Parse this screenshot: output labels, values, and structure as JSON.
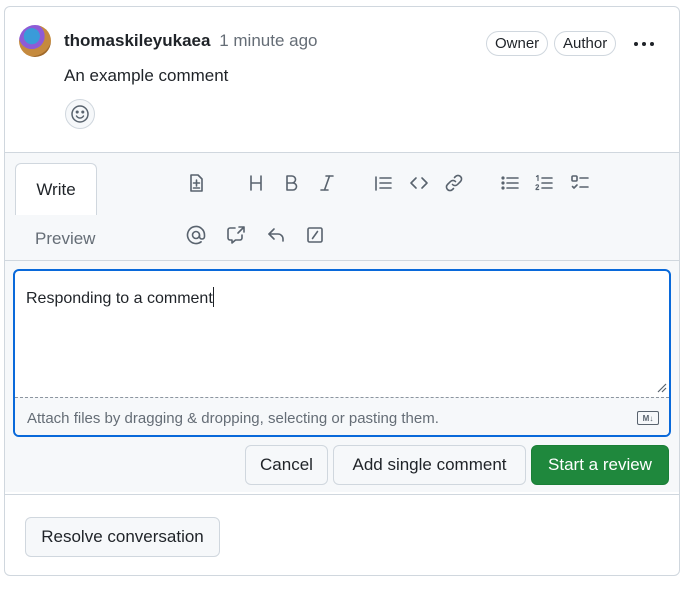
{
  "comment": {
    "author": "thomaskileyukaea",
    "timestamp": "1 minute ago",
    "badges": [
      "Owner",
      "Author"
    ],
    "body": "An example comment",
    "menu_icon": "kebab-horizontal-icon",
    "reaction_icon": "smiley-icon"
  },
  "editor": {
    "tabs": {
      "write": "Write",
      "preview": "Preview"
    },
    "toolbar_icons": [
      "file-diff-icon",
      "heading-icon",
      "bold-icon",
      "italic-icon",
      "quote-icon",
      "code-icon",
      "link-icon",
      "unordered-list-icon",
      "ordered-list-icon",
      "task-list-icon",
      "mention-icon",
      "cross-reference-icon",
      "reply-icon",
      "slash-command-icon"
    ],
    "value": "Responding to a comment",
    "attach_hint": "Attach files by dragging & dropping, selecting or pasting them.",
    "markdown_icon": "markdown-icon"
  },
  "actions": {
    "cancel": "Cancel",
    "add_single": "Add single comment",
    "start_review": "Start a review"
  },
  "resolve": "Resolve conversation",
  "colors": {
    "primary": "#1f883d",
    "focus": "#0969da",
    "border": "#d0d7de",
    "muted": "#656d76"
  }
}
